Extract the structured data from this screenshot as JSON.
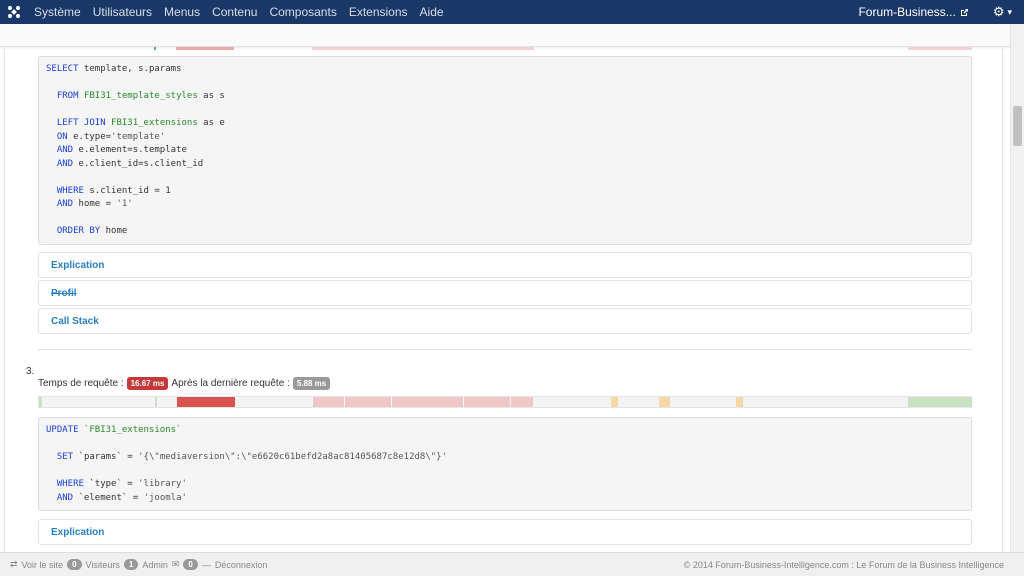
{
  "nav": {
    "menu": [
      "Système",
      "Utilisateurs",
      "Menus",
      "Contenu",
      "Composants",
      "Extensions",
      "Aide"
    ],
    "site_title": "Forum-Business...",
    "gear_caret": "▾"
  },
  "query2": {
    "lines": [
      [
        {
          "t": "kw",
          "v": "SELECT"
        },
        {
          "t": "n",
          "v": " template, s.params"
        }
      ],
      [],
      [
        {
          "t": "n",
          "v": "  "
        },
        {
          "t": "kw",
          "v": "FROM"
        },
        {
          "t": "n",
          "v": " "
        },
        {
          "t": "tb",
          "v": "FBI31_template_styles"
        },
        {
          "t": "n",
          "v": " as s"
        }
      ],
      [],
      [
        {
          "t": "n",
          "v": "  "
        },
        {
          "t": "kw",
          "v": "LEFT JOIN"
        },
        {
          "t": "n",
          "v": " "
        },
        {
          "t": "tb",
          "v": "FBI31_extensions"
        },
        {
          "t": "n",
          "v": " as e"
        }
      ],
      [
        {
          "t": "n",
          "v": "  "
        },
        {
          "t": "kw",
          "v": "ON"
        },
        {
          "t": "n",
          "v": " e.type="
        },
        {
          "t": "str",
          "v": "'template'"
        }
      ],
      [
        {
          "t": "n",
          "v": "  "
        },
        {
          "t": "kw",
          "v": "AND"
        },
        {
          "t": "n",
          "v": " e.element=s.template"
        }
      ],
      [
        {
          "t": "n",
          "v": "  "
        },
        {
          "t": "kw",
          "v": "AND"
        },
        {
          "t": "n",
          "v": " e.client_id=s.client_id"
        }
      ],
      [],
      [
        {
          "t": "n",
          "v": "  "
        },
        {
          "t": "kw",
          "v": "WHERE"
        },
        {
          "t": "n",
          "v": " s.client_id = 1"
        }
      ],
      [
        {
          "t": "n",
          "v": "  "
        },
        {
          "t": "kw",
          "v": "AND"
        },
        {
          "t": "n",
          "v": " home = "
        },
        {
          "t": "str",
          "v": "'1'"
        }
      ],
      [],
      [
        {
          "t": "n",
          "v": "  "
        },
        {
          "t": "kw",
          "v": "ORDER BY"
        },
        {
          "t": "n",
          "v": " home"
        }
      ]
    ],
    "accordions": [
      {
        "label": "Explication",
        "strike": false
      },
      {
        "label": "Profil",
        "strike": true
      },
      {
        "label": "Call Stack",
        "strike": false
      }
    ]
  },
  "query3": {
    "number": "3.",
    "time_label": "Temps de requête :",
    "time_value": "16.67 ms",
    "after_label": "Après la dernière requête :",
    "after_value": "5.88 ms",
    "lines": [
      [
        {
          "t": "kw",
          "v": "UPDATE"
        },
        {
          "t": "n",
          "v": " "
        },
        {
          "t": "tb",
          "v": "`FBI31_extensions`"
        }
      ],
      [],
      [
        {
          "t": "n",
          "v": "  "
        },
        {
          "t": "kw",
          "v": "SET"
        },
        {
          "t": "n",
          "v": " `params` = "
        },
        {
          "t": "str",
          "v": "'{\\\"mediaversion\\\":\\\"e6620c61befd2a8ac81405687c8e12d8\\\"}'"
        }
      ],
      [],
      [
        {
          "t": "n",
          "v": "  "
        },
        {
          "t": "kw",
          "v": "WHERE"
        },
        {
          "t": "n",
          "v": " `type` = "
        },
        {
          "t": "str",
          "v": "'library'"
        }
      ],
      [
        {
          "t": "n",
          "v": "  "
        },
        {
          "t": "kw",
          "v": "AND"
        },
        {
          "t": "n",
          "v": " `element` = "
        },
        {
          "t": "str",
          "v": "'joomla'"
        }
      ]
    ],
    "accordion_label": "Explication"
  },
  "colors": {
    "timeline_green": "#c9e2c4",
    "timeline_red": "#d9534f",
    "timeline_pink": "#efc7c7",
    "timeline_orange": "#f5d8a8"
  },
  "footer": {
    "view_site": "Voir le site",
    "visitors_count": "0",
    "visitors_label": "Visiteurs",
    "admin_count": "1",
    "admin_label": "Admin",
    "messages_count": "0",
    "logout_label": "Déconnexion",
    "copyright": "© 2014 Forum-Business-Intelligence.com : Le Forum de la Business Intelligence"
  }
}
